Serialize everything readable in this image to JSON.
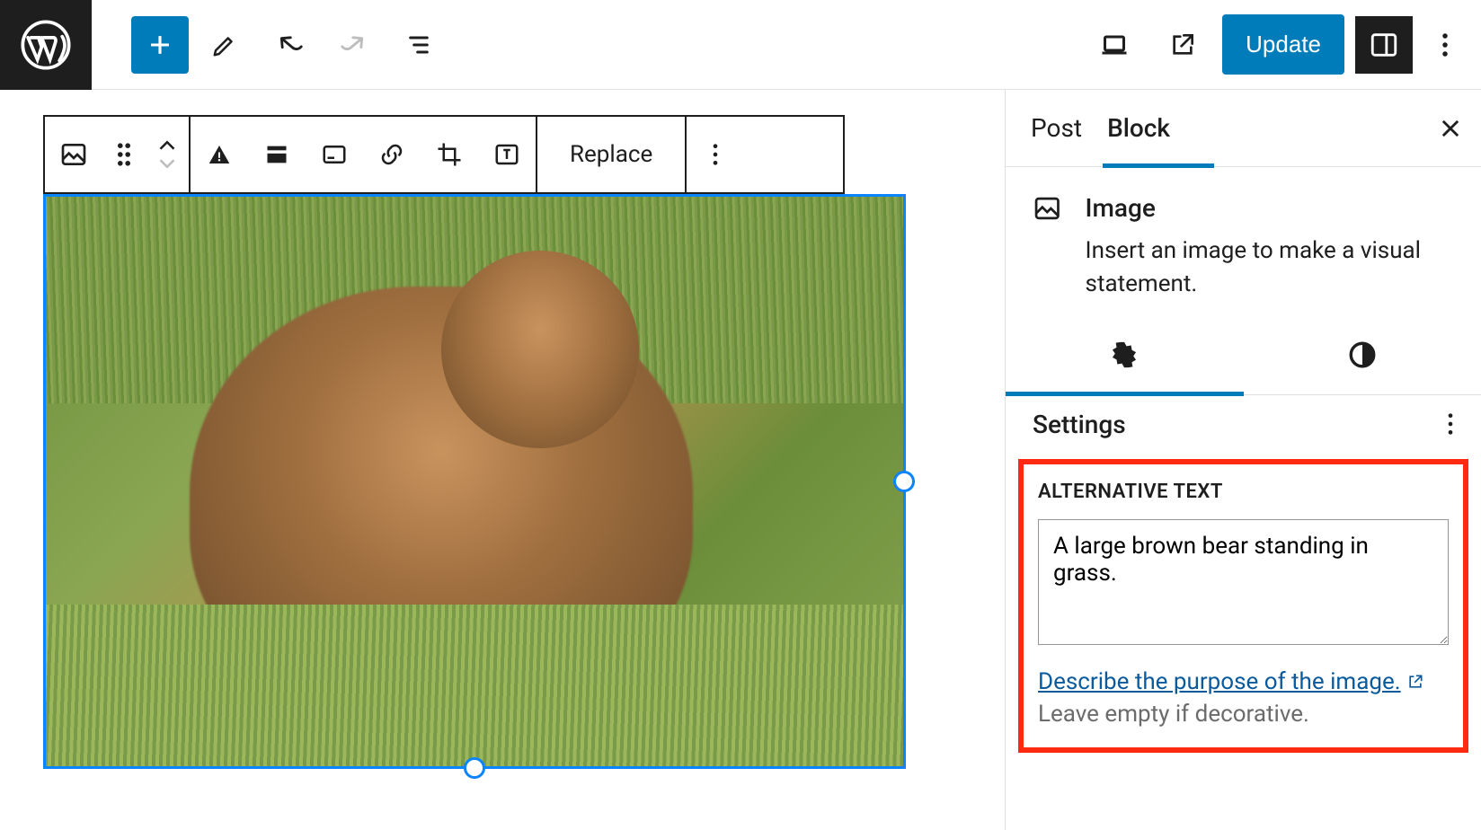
{
  "topbar": {
    "update_label": "Update"
  },
  "block_toolbar": {
    "replace_label": "Replace"
  },
  "sidebar": {
    "tabs": {
      "post": "Post",
      "block": "Block"
    },
    "block_card": {
      "title": "Image",
      "desc": "Insert an image to make a visual statement."
    },
    "settings_header": "Settings",
    "alt": {
      "label": "ALTERNATIVE TEXT",
      "value": "A large brown bear standing in grass.",
      "link": "Describe the purpose of the image.",
      "hint": "Leave empty if decorative."
    }
  }
}
